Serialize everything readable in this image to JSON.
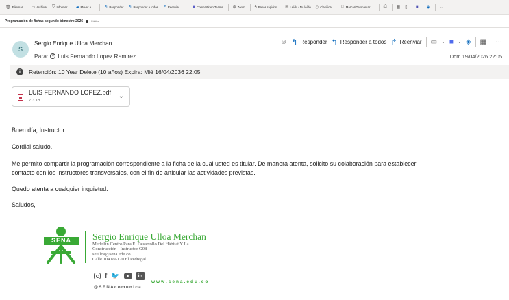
{
  "ribbon": {
    "items": [
      {
        "label": "Eliminar",
        "icon": "trash-icon"
      },
      {
        "label": "Archivar",
        "icon": "archive-icon"
      },
      {
        "label": "Informar",
        "icon": "shield-icon"
      },
      {
        "label": "Mover a",
        "icon": "move-folder-icon"
      },
      {
        "label": "Responder",
        "icon": "reply-icon"
      },
      {
        "label": "Responder a todos",
        "icon": "reply-all-icon"
      },
      {
        "label": "Reenviar",
        "icon": "forward-icon"
      },
      {
        "label": "Compartir en Teams",
        "icon": "teams-icon"
      },
      {
        "label": "Zoom",
        "icon": "zoom-icon"
      },
      {
        "label": "Pasos rápidos",
        "icon": "lightning-icon"
      },
      {
        "label": "Leído / No leído",
        "icon": "envelope-icon"
      },
      {
        "label": "Clasificar",
        "icon": "tag-icon"
      },
      {
        "label": "Marcar/Desmarcar",
        "icon": "flag-icon"
      }
    ],
    "more_label": "···"
  },
  "message": {
    "subject": "Programación de fichas segundo trimestre 2026",
    "subject_tag": "Pública",
    "avatar_letter": "S",
    "sender": "Sergio Enrique Ulloa Merchan",
    "to_label": "Para:",
    "to_name": "Luis Fernando Lopez Ramirez",
    "date": "Dom 19/04/2026 22:05",
    "retention": "Retención: 10 Year Delete (10 años) Expira: Mié 16/04/2036 22:05"
  },
  "actions": {
    "reply": "Responder",
    "reply_all": "Responder a todos",
    "forward": "Reenviar",
    "more": "···"
  },
  "attachment": {
    "name": "LUIS FERNANDO LOPEZ.pdf",
    "size": "213 KB"
  },
  "body": {
    "greeting": "Buen día, Instructor:",
    "salute": "Cordial saludo.",
    "para1_line1": "Me permito compartir la programación correspondiente a la ficha de la cual usted es titular. De manera atenta, solicito su colaboración para establecer",
    "para1_line2": "contacto con los instructores transversales, con el fin de articular las actividades previstas.",
    "para2": "Quedo atenta a cualquier inquietud.",
    "closing": "Saludos,"
  },
  "signature": {
    "logo_text": "SENA",
    "name": "Sergio Enrique Ulloa Merchan",
    "line1": "Medellín Centro Para El Desarrollo Del Hábitat Y La",
    "line2": "Construcción - Instructor G08",
    "line3": "seulloa@sena.edu.co",
    "line4": "Calle.104  69-120 El Pedregal",
    "website": "www.sena.edu.co",
    "handle": "@SENAcomunica",
    "brand_color": "#39a935"
  }
}
